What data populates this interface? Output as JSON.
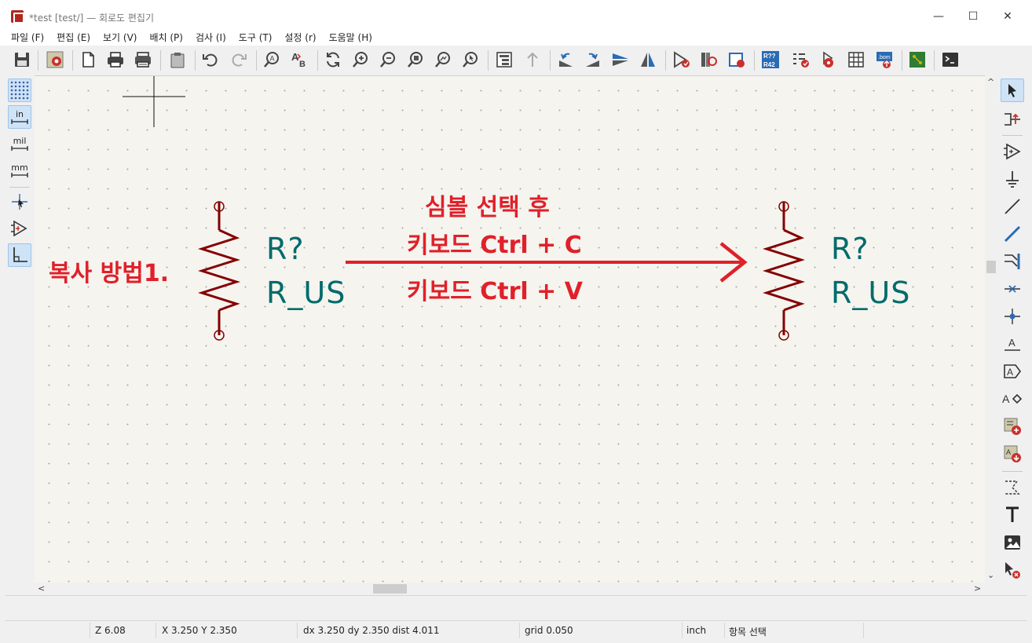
{
  "window": {
    "title": "*test [test/] — 회로도 편집기",
    "controls": {
      "minimize": "—",
      "maximize": "☐",
      "close": "✕"
    }
  },
  "menubar": {
    "items": [
      {
        "label": "파일 (F)"
      },
      {
        "label": "편집 (E)"
      },
      {
        "label": "보기 (V)"
      },
      {
        "label": "배치 (P)"
      },
      {
        "label": "검사 (I)"
      },
      {
        "label": "도구 (T)"
      },
      {
        "label": "설정 (r)"
      },
      {
        "label": "도움말 (H)"
      }
    ]
  },
  "toolbar": {
    "buttons": [
      "save-icon",
      "schematic-setup-icon",
      "page-settings-icon",
      "print-icon",
      "plot-icon",
      "paste-icon",
      "undo-icon",
      "redo-icon",
      "find-icon",
      "find-replace-icon",
      "refresh-icon",
      "zoom-in-icon",
      "zoom-out-icon",
      "zoom-fit-icon",
      "zoom-objects-icon",
      "zoom-selection-icon",
      "hierarchy-navigator-icon",
      "leave-sheet-icon",
      "rotate-ccw-icon",
      "rotate-cw-icon",
      "mirror-vertical-icon",
      "mirror-horizontal-icon",
      "symbol-editor-icon",
      "symbol-browser-icon",
      "footprint-assignment-icon",
      "annotate-icon",
      "erc-icon",
      "update-from-pcb-icon",
      "symbol-fields-table-icon",
      "bom-icon",
      "pcb-editor-icon",
      "scripting-console-icon"
    ]
  },
  "left_toolbar": {
    "buttons": [
      {
        "name": "grid-toggle-icon",
        "active": true
      },
      {
        "name": "units-inch-icon",
        "label": "in",
        "active": true
      },
      {
        "name": "units-mil-icon",
        "label": "mil",
        "active": false
      },
      {
        "name": "units-mm-icon",
        "label": "mm",
        "active": false
      },
      {
        "name": "cursor-style-icon",
        "active": false
      },
      {
        "name": "hidden-pins-icon",
        "active": false
      },
      {
        "name": "line-modes-icon",
        "active": true
      }
    ]
  },
  "right_toolbar": {
    "buttons": [
      "select-icon",
      "highlight-net-icon",
      "add-symbol-icon",
      "add-power-icon",
      "add-wire-icon",
      "add-bus-icon",
      "add-bus-entry-icon",
      "no-connect-icon",
      "add-junction-icon",
      "add-label-icon",
      "add-global-label-icon",
      "add-hierarchical-label-icon",
      "add-sheet-icon",
      "import-sheet-pin-icon",
      "add-graphic-line-icon",
      "add-text-icon",
      "add-image-icon",
      "delete-icon"
    ]
  },
  "canvas": {
    "symbols": [
      {
        "reference": "R?",
        "value": "R_US"
      },
      {
        "reference": "R?",
        "value": "R_US"
      }
    ],
    "annotations": {
      "method_label": "복사 방법1.",
      "line1": "심볼 선택 후",
      "line2": "키보드 Ctrl + C",
      "line3": "키보드 Ctrl + V"
    },
    "colors": {
      "annotation": "#e0202a",
      "symbol_body": "#840000",
      "symbol_text": "#006b6b",
      "background": "#f5f4ef"
    }
  },
  "statusbar": {
    "zoom": "Z 6.08",
    "position": "X 3.250  Y 2.350",
    "delta": "dx 3.250  dy 2.350  dist 4.011",
    "grid": "grid 0.050",
    "units": "inch",
    "mode": "항목 선택"
  }
}
